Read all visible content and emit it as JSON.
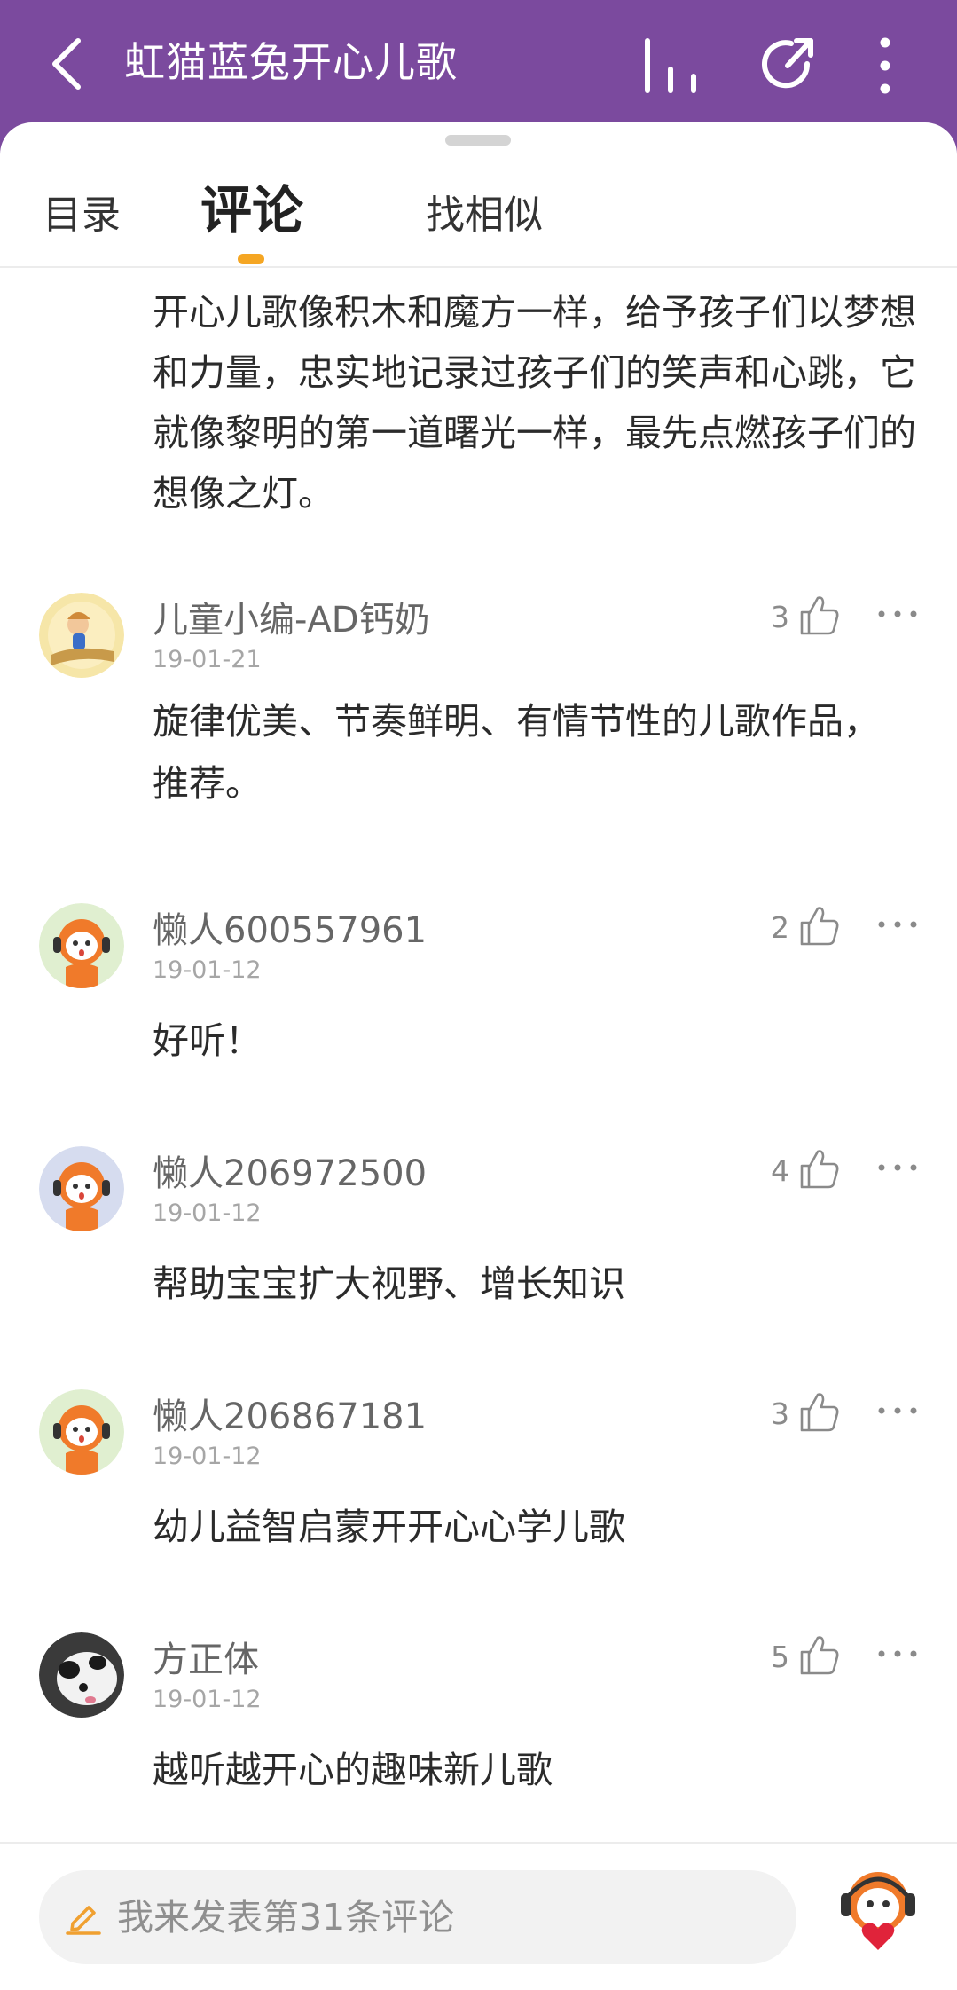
{
  "header": {
    "title": "虹猫蓝兔开心儿歌",
    "back_icon": "back-arrow-icon",
    "icons": [
      "equalizer-icon",
      "share-icon",
      "more-vertical-icon"
    ],
    "background": "#7b4a9e"
  },
  "tabs": [
    {
      "label": "目录",
      "active": false
    },
    {
      "label": "评论",
      "active": true
    },
    {
      "label": "找相似",
      "active": false
    }
  ],
  "intro_text": "开心儿歌像积木和魔方一样，给予孩子们以梦想和力量，忠实地记录过孩子们的笑声和心跳，它就像黎明的第一道曙光一样，最先点燃孩子们的想像之灯。",
  "comments": [
    {
      "user": "儿童小编-AD钙奶",
      "date": "19-01-21",
      "likes": "3",
      "text": "旋律优美、节奏鲜明、有情节性的儿歌作品，推荐。"
    },
    {
      "user": "懒人600557961",
      "date": "19-01-12",
      "likes": "2",
      "text": "好听！"
    },
    {
      "user": "懒人206972500",
      "date": "19-01-12",
      "likes": "4",
      "text": "帮助宝宝扩大视野、增长知识"
    },
    {
      "user": "懒人206867181",
      "date": "19-01-12",
      "likes": "3",
      "text": "幼儿益智启蒙开开心心学儿歌"
    },
    {
      "user": "方正体",
      "date": "19-01-12",
      "likes": "5",
      "text": "越听越开心的趣味新儿歌"
    }
  ],
  "composer": {
    "placeholder": "我来发表第31条评论",
    "icon": "pencil-icon"
  },
  "colors": {
    "accent": "#7b4a9e",
    "tab_indicator": "#f5a623",
    "pencil": "#f0a030"
  }
}
